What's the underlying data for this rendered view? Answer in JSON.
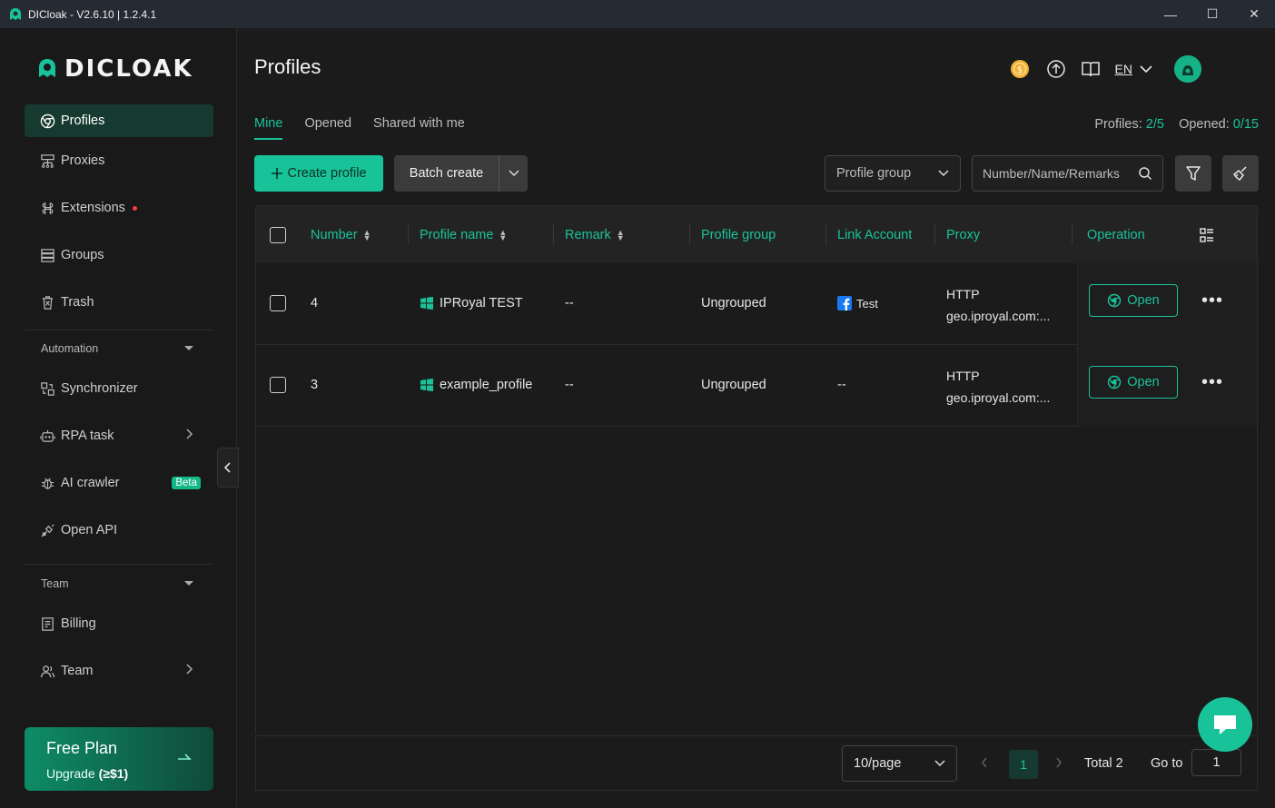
{
  "window": {
    "title": "DICloak - V2.6.10 | 1.2.4.1",
    "minimize": "—",
    "maximize": "☐",
    "close": "✕"
  },
  "brand": {
    "wordmark": "DICLOAK"
  },
  "sidebar": {
    "items": [
      {
        "label": "Profiles",
        "icon": "chrome-icon"
      },
      {
        "label": "Proxies",
        "icon": "proxies-icon"
      },
      {
        "label": "Extensions",
        "icon": "extensions-icon"
      },
      {
        "label": "Groups",
        "icon": "groups-icon"
      },
      {
        "label": "Trash",
        "icon": "trash-icon"
      }
    ],
    "automation_label": "Automation",
    "automation_items": [
      {
        "label": "Synchronizer",
        "icon": "synchronizer-icon"
      },
      {
        "label": "RPA task",
        "icon": "robot-icon"
      },
      {
        "label": "AI crawler",
        "icon": "bug-icon",
        "badge": "Beta"
      },
      {
        "label": "Open API",
        "icon": "api-icon"
      }
    ],
    "team_label": "Team",
    "team_items": [
      {
        "label": "Billing",
        "icon": "billing-icon"
      },
      {
        "label": "Team",
        "icon": "users-icon"
      }
    ],
    "plan": {
      "title": "Free Plan",
      "upgrade": "Upgrade",
      "price": "(≥$1)"
    }
  },
  "header": {
    "title": "Profiles",
    "language": "EN"
  },
  "tabs": [
    {
      "label": "Mine",
      "active": true
    },
    {
      "label": "Opened",
      "active": false
    },
    {
      "label": "Shared with me",
      "active": false
    }
  ],
  "counts": {
    "profiles_label": "Profiles:",
    "profiles_value": "2/5",
    "opened_label": "Opened:",
    "opened_value": "0/15"
  },
  "toolbar": {
    "create_label": "Create profile",
    "batch_label": "Batch create",
    "group_select": "Profile group",
    "search_placeholder": "Number/Name/Remarks"
  },
  "table": {
    "columns": [
      "Number",
      "Profile name",
      "Remark",
      "Profile group",
      "Link Account",
      "Proxy",
      "Operation"
    ],
    "rows": [
      {
        "number": "4",
        "name": "IPRoyal TEST",
        "remark": "--",
        "group": "Ungrouped",
        "account": "Test",
        "proxy_type": "HTTP",
        "proxy_host": "geo.iproyal.com:...",
        "open": "Open"
      },
      {
        "number": "3",
        "name": "example_profile",
        "remark": "--",
        "group": "Ungrouped",
        "account": "--",
        "proxy_type": "HTTP",
        "proxy_host": "geo.iproyal.com:...",
        "open": "Open"
      }
    ]
  },
  "pagination": {
    "page_size": "10/page",
    "current_page": "1",
    "total": "Total 2",
    "goto_label": "Go to",
    "goto_value": "1"
  },
  "colors": {
    "accent": "#19c39a",
    "background": "#1b1b1b",
    "sidebar_active": "#173a30"
  }
}
